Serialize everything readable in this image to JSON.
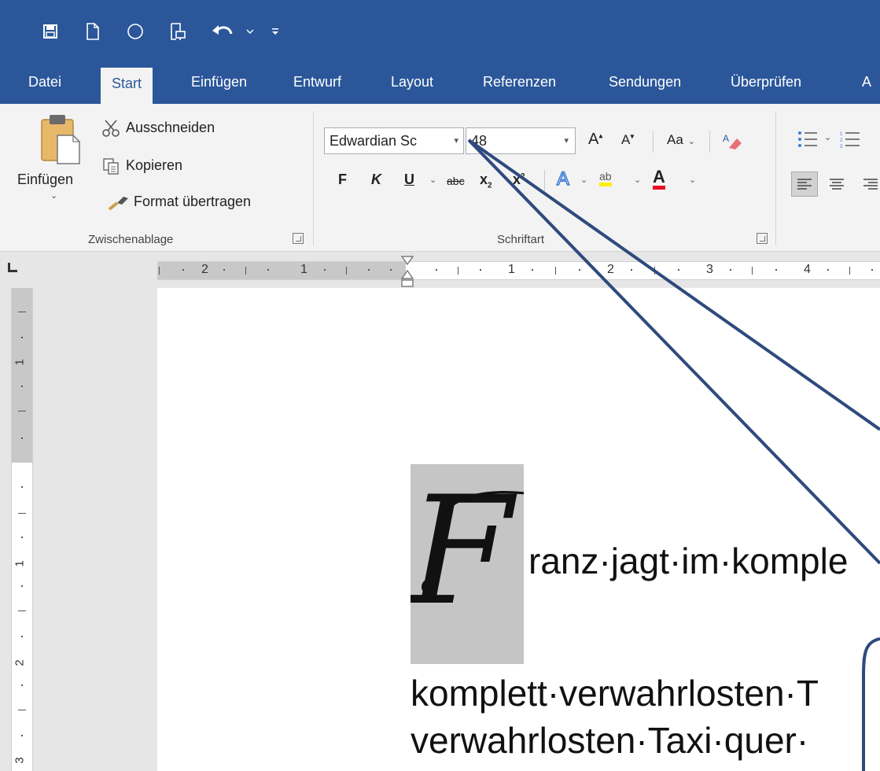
{
  "ribbon_tabs": [
    {
      "label": "Datei"
    },
    {
      "label": "Start"
    },
    {
      "label": "Einfügen"
    },
    {
      "label": "Entwurf"
    },
    {
      "label": "Layout"
    },
    {
      "label": "Referenzen"
    },
    {
      "label": "Sendungen"
    },
    {
      "label": "Überprüfen"
    },
    {
      "label": "A"
    }
  ],
  "active_tab": "Start",
  "clipboard": {
    "paste_label": "Einfügen",
    "cut_label": "Ausschneiden",
    "copy_label": "Kopieren",
    "format_painter_label": "Format übertragen",
    "group_label": "Zwischenablage"
  },
  "font": {
    "font_name": "Edwardian Sc",
    "font_size": "48",
    "change_case_label": "Aa",
    "bold_label": "F",
    "italic_label": "K",
    "underline_label": "U",
    "strikethrough_label": "abc",
    "subscript_label": "x",
    "subscript_mark": "2",
    "superscript_label": "x",
    "superscript_mark": "2",
    "grow_label": "A",
    "shrink_label": "A",
    "text_effects_label": "A",
    "highlight_label": "ab",
    "font_color_label": "A",
    "group_label": "Schriftart"
  },
  "ruler": {
    "h_numbers": [
      "2",
      "1",
      "1",
      "2",
      "3",
      "4"
    ],
    "v_numbers": [
      "1",
      "1",
      "2",
      "3"
    ]
  },
  "document": {
    "dropcap_letter": "F",
    "line1": "ranz·jagt·im·komple",
    "line2": "komplett·verwahrlosten·T",
    "line3": "verwahrlosten·Taxi·quer·"
  },
  "colors": {
    "titlebar": "#2b579a",
    "ribbon": "#f3f3f3",
    "dropcap_frame": "#c5c5c5",
    "annotation": "#2e4a7d",
    "highlight_yellow": "#ffee00",
    "font_color_red": "#e81123"
  },
  "icons": {
    "save": "save-icon",
    "new": "new-document-icon",
    "circle": "circle-icon",
    "touch": "touch-mode-icon",
    "undo": "undo-icon",
    "customize": "customize-qat-icon",
    "paste": "paste-icon",
    "cut": "scissors-icon",
    "copy": "copy-icon",
    "format_painter": "brush-icon",
    "clear_formatting": "eraser-icon",
    "bullets": "bullet-list-icon",
    "numbering": "numbered-list-icon",
    "align_left": "align-left-icon",
    "align_center": "align-center-icon"
  }
}
